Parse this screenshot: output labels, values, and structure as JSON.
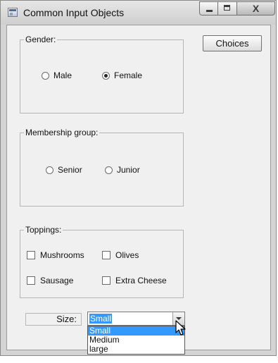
{
  "window": {
    "title": "Common Input Objects",
    "caption_buttons": {
      "minimize_icon": "minimize-icon",
      "maximize_icon": "maximize-icon",
      "close_glyph": "X"
    }
  },
  "gender_group": {
    "title": "Gender:",
    "options": [
      {
        "label": "Male",
        "checked": false
      },
      {
        "label": "Female",
        "checked": true
      }
    ]
  },
  "membership_group": {
    "title": "Membership group:",
    "options": [
      {
        "label": "Senior",
        "checked": false
      },
      {
        "label": "Junior",
        "checked": false
      }
    ]
  },
  "toppings_group": {
    "title": "Toppings:",
    "options": [
      {
        "label": "Mushrooms",
        "checked": false
      },
      {
        "label": "Olives",
        "checked": false
      },
      {
        "label": "Sausage",
        "checked": false
      },
      {
        "label": "Extra Cheese",
        "checked": false
      }
    ]
  },
  "choices_button": {
    "label": "Choices"
  },
  "size": {
    "label": "Size:",
    "selected": "Small",
    "options": [
      "Small",
      "Medium",
      "large"
    ]
  },
  "colors": {
    "selection": "#3399ff",
    "client_bg": "#f0f0f0"
  }
}
